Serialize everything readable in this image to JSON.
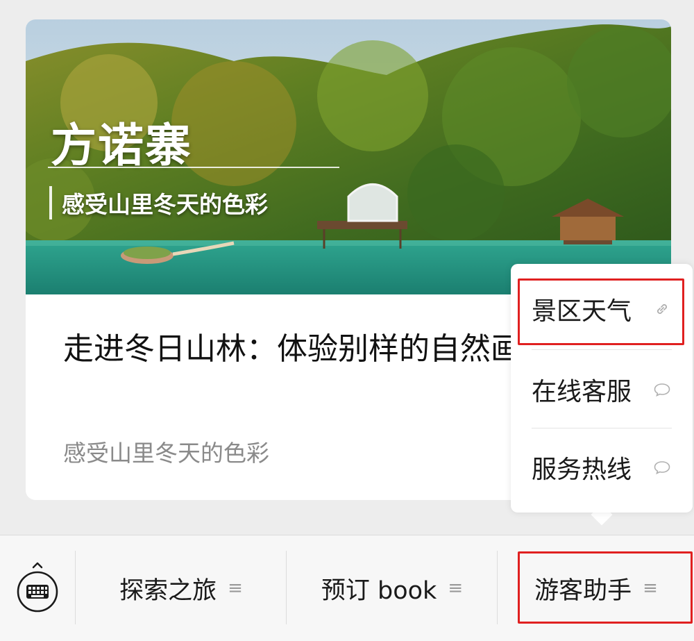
{
  "article": {
    "cover_title": "方诺寨",
    "cover_subtitle": "感受山里冬天的色彩",
    "headline": "走进冬日山林：体验别样的自然画卷",
    "digest": "感受山里冬天的色彩"
  },
  "popup": {
    "items": [
      {
        "label": "景区天气",
        "icon": "link-icon"
      },
      {
        "label": "在线客服",
        "icon": "chat-bubble-icon"
      },
      {
        "label": "服务热线",
        "icon": "chat-bubble-icon"
      }
    ]
  },
  "menubar": {
    "keyboard_icon": "keyboard-icon",
    "items": [
      {
        "label": "探索之旅",
        "icon": "submenu-lines-icon"
      },
      {
        "label": "预订 book",
        "icon": "submenu-lines-icon"
      },
      {
        "label": "游客助手",
        "icon": "submenu-lines-icon"
      }
    ],
    "lines_glyph": "≡"
  },
  "colors": {
    "highlight": "#e02020",
    "background": "#ededed"
  }
}
